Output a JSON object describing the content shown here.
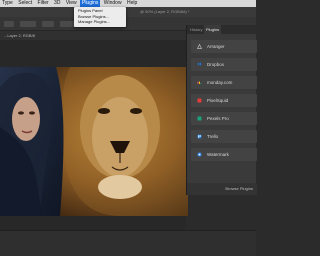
{
  "menubar": {
    "items": [
      "Type",
      "Select",
      "Filter",
      "3D",
      "View",
      "Plugins",
      "Window",
      "Help"
    ],
    "active_index": 5
  },
  "document_title": "@ 50% (Layer 2, RGB/8#) *",
  "tab_label": "...Layer 2, RGB/8",
  "plugins_menu": {
    "items": [
      "Plugins Panel",
      "Browse Plugins...",
      "Manage Plugins..."
    ]
  },
  "panel": {
    "tabs": [
      "History",
      "Plugins"
    ],
    "selected_tab": "Plugins",
    "plugins": [
      {
        "label": "Arranger",
        "icon": "triangle-icon",
        "color": "#bdbdbd"
      },
      {
        "label": "Dropbox",
        "icon": "dropbox-icon",
        "color": "#1e7be0"
      },
      {
        "label": "monday.com",
        "icon": "monday-icon",
        "color": "#f25b63"
      },
      {
        "label": "PixelSquid",
        "icon": "pixelsquid-icon",
        "color": "#e63b3b"
      },
      {
        "label": "Pexels Pro",
        "icon": "pexels-icon",
        "color": "#1aa37a"
      },
      {
        "label": "Trello",
        "icon": "trello-icon",
        "color": "#1f78d0"
      },
      {
        "label": "Watermark",
        "icon": "watermark-icon",
        "color": "#3e8be8"
      }
    ],
    "footer": "Browse Plugins"
  }
}
